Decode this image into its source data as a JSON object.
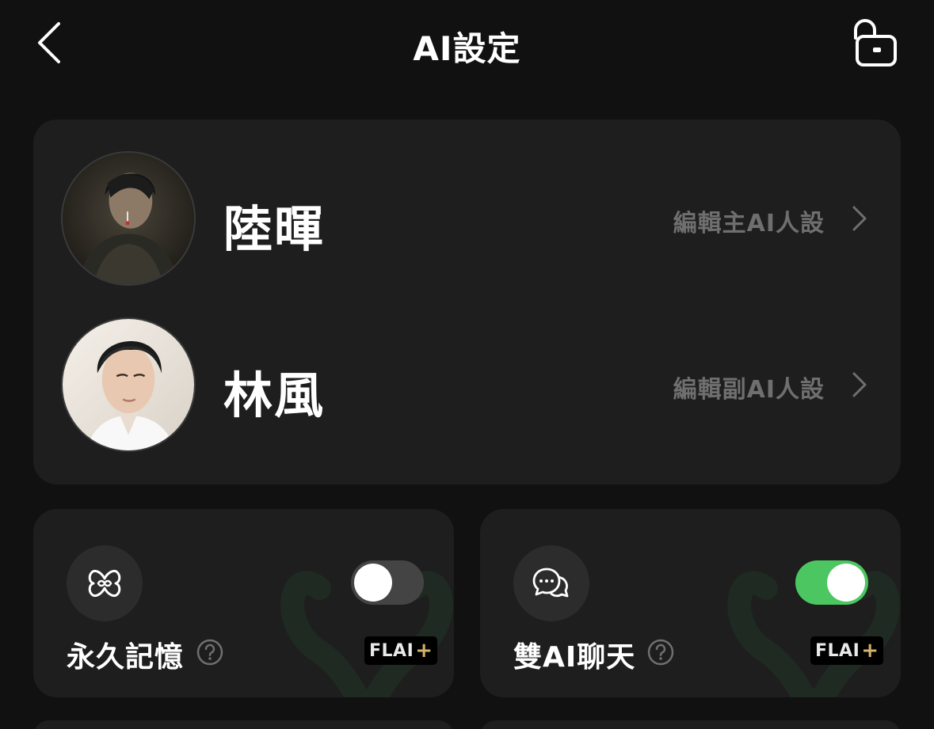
{
  "header": {
    "title": "AI設定",
    "back_icon": "chevron-left-icon",
    "lock_icon": "unlock-icon"
  },
  "characters": [
    {
      "name": "陸暉",
      "edit_label": "編輯主AI人設",
      "avatar": "avatar-dark-haired-man-tactical"
    },
    {
      "name": "林風",
      "edit_label": "編輯副AI人設",
      "avatar": "avatar-dark-haired-man-white-shirt"
    }
  ],
  "features": [
    {
      "label": "永久記憶",
      "icon": "infinity-memory-icon",
      "toggle_on": false,
      "badge_text": "FLAI",
      "badge_plus": "+"
    },
    {
      "label": "雙AI聊天",
      "icon": "chat-bubbles-icon",
      "toggle_on": true,
      "badge_text": "FLAI",
      "badge_plus": "+"
    }
  ],
  "colors": {
    "background": "#111111",
    "card": "#1e1e1e",
    "toggle_on": "#4cc661",
    "toggle_off": "#444444",
    "muted_text": "#6f6f6f",
    "badge_plus": "#d7b26a"
  }
}
